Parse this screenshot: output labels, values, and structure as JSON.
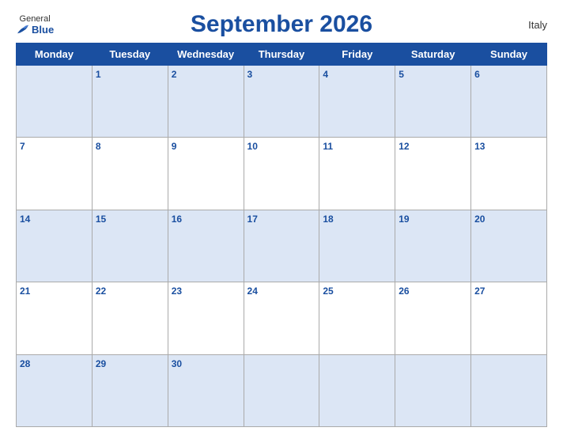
{
  "header": {
    "title": "September 2026",
    "logo": {
      "general": "General",
      "blue": "Blue"
    },
    "country": "Italy"
  },
  "calendar": {
    "days_of_week": [
      "Monday",
      "Tuesday",
      "Wednesday",
      "Thursday",
      "Friday",
      "Saturday",
      "Sunday"
    ],
    "weeks": [
      [
        "",
        "1",
        "2",
        "3",
        "4",
        "5",
        "6"
      ],
      [
        "7",
        "8",
        "9",
        "10",
        "11",
        "12",
        "13"
      ],
      [
        "14",
        "15",
        "16",
        "17",
        "18",
        "19",
        "20"
      ],
      [
        "21",
        "22",
        "23",
        "24",
        "25",
        "26",
        "27"
      ],
      [
        "28",
        "29",
        "30",
        "",
        "",
        "",
        ""
      ]
    ]
  }
}
